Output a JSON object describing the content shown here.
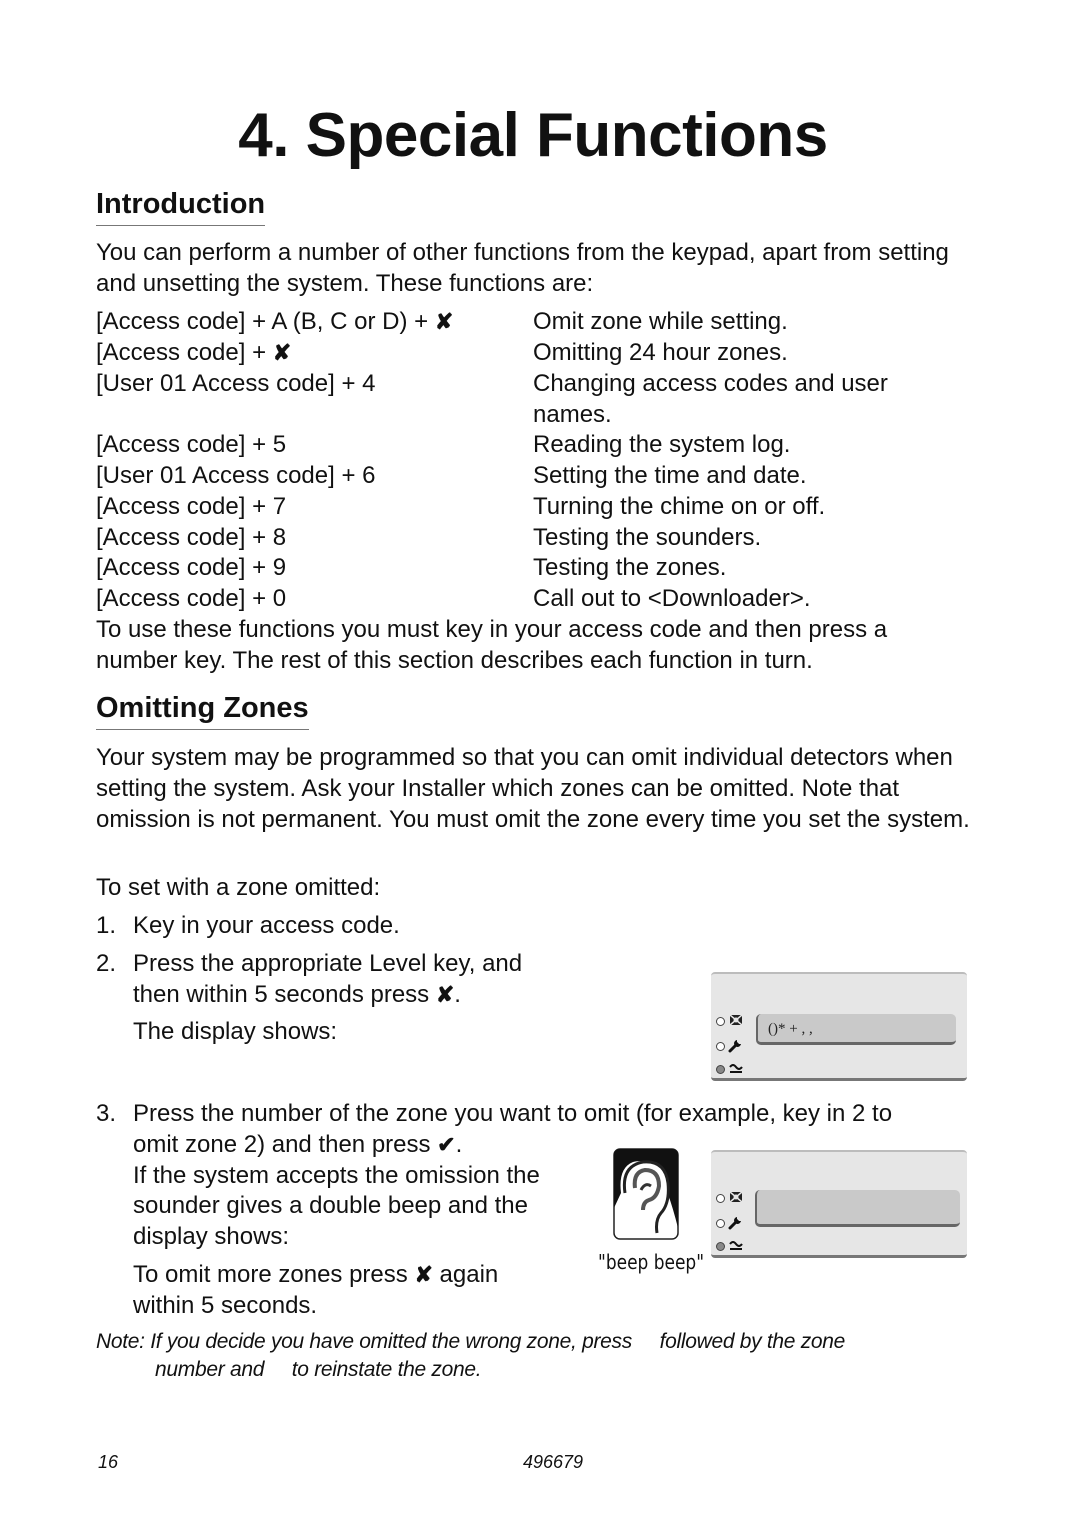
{
  "page_title": "4. Special Functions",
  "introduction": {
    "heading": "Introduction",
    "intro_text": "You can perform a number of other functions from the keypad, apart from setting and unsetting the system. These functions are:",
    "functions": [
      {
        "keys": "[Access code] + A (B, C or D) + ",
        "key_icon": "✘",
        "description": "Omit zone while setting."
      },
      {
        "keys": "[Access code] + ",
        "key_icon": "✘",
        "description": "Omitting 24 hour zones."
      },
      {
        "keys": "[User 01 Access code] + 4",
        "key_icon": "",
        "description": "Changing access codes and user",
        "description_cont": "names."
      },
      {
        "keys": "[Access code] + 5",
        "key_icon": "",
        "description": "Reading the system log."
      },
      {
        "keys": "[User 01 Access code] + 6",
        "key_icon": "",
        "description": "Setting the time and date."
      },
      {
        "keys": "[Access code] + 7",
        "key_icon": "",
        "description": "Turning the chime on or off."
      },
      {
        "keys": "[Access code] + 8",
        "key_icon": "",
        "description": "Testing the sounders."
      },
      {
        "keys": "[Access code] + 9",
        "key_icon": "",
        "description": "Testing the zones."
      },
      {
        "keys": "[Access code] + 0",
        "key_icon": "",
        "description": "Call out to <Downloader>."
      }
    ],
    "outro_text": "To use these functions you must key in your access code and then press a number key. The rest of this section describes each function in turn."
  },
  "omitting_zones": {
    "heading": "Omitting Zones",
    "body": "Your system may be programmed so that you can omit individual detectors when setting the system. Ask your Installer which zones can be omitted. Note that omission is not permanent. You must omit the zone every time you set the system.",
    "lead_in": "To set with a zone omitted:",
    "steps": [
      {
        "num": "1.",
        "text": "Key in your access code."
      },
      {
        "num": "2.",
        "line1": "Press the appropriate Level key, and",
        "line2": "then within 5 seconds press ",
        "icon": "✘",
        "line2_end": ".",
        "line3": "The display shows:"
      },
      {
        "num": "3.",
        "line1": "Press the number of the zone you want to omit (for example, key in 2 to",
        "line2": "omit zone 2) and then press ",
        "icon": "✔",
        "line2_end": ".",
        "line3": "If the system accepts the omission the",
        "line4": "sounder gives a double beep and the",
        "line5": "display shows:",
        "line6a": "To omit more zones press ",
        "icon2": "✘",
        "line6b": " again",
        "line7": "within 5 seconds."
      }
    ],
    "display1_text": "()*   +     , ,",
    "display2_text": "",
    "beep_caption": "\"beep beep\"",
    "note_line1": "Note: If you decide you have omitted the wrong zone, press     followed by the zone",
    "note_line2": "number and     to reinstate the zone."
  },
  "footer": {
    "page_number": "16",
    "doc_number": "496679"
  }
}
